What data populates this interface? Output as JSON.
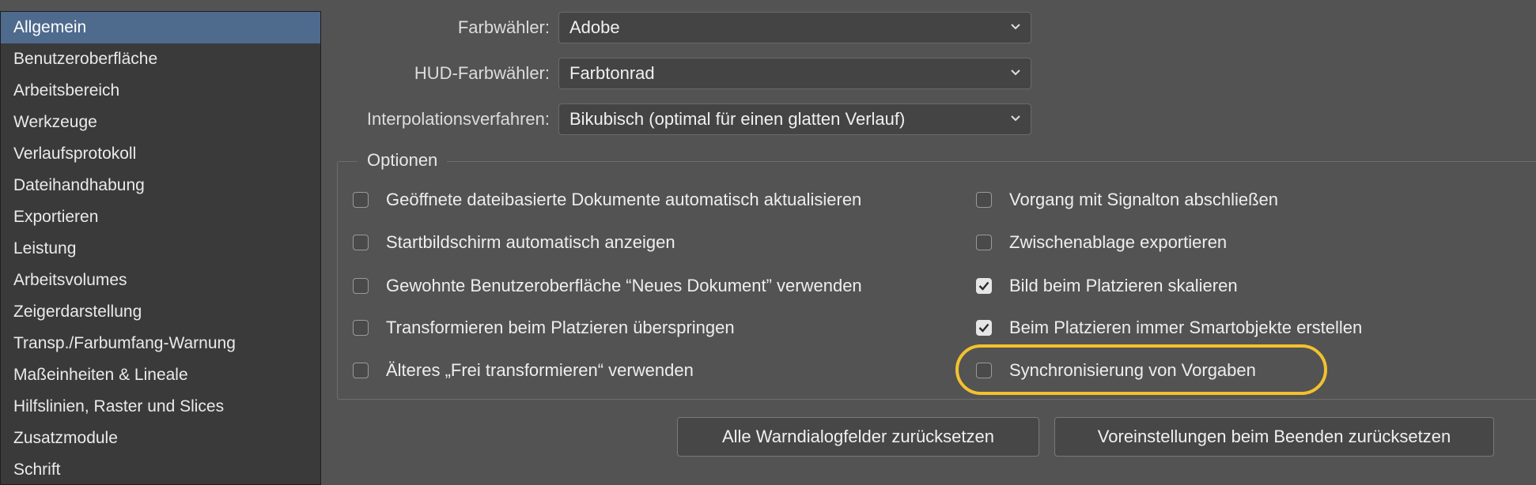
{
  "sidebar": {
    "items": [
      {
        "label": "Allgemein",
        "active": true
      },
      {
        "label": "Benutzeroberfläche"
      },
      {
        "label": "Arbeitsbereich"
      },
      {
        "label": "Werkzeuge"
      },
      {
        "label": "Verlaufsprotokoll"
      },
      {
        "label": "Dateihandhabung"
      },
      {
        "label": "Exportieren"
      },
      {
        "label": "Leistung"
      },
      {
        "label": "Arbeitsvolumes"
      },
      {
        "label": "Zeigerdarstellung"
      },
      {
        "label": "Transp./Farbumfang-Warnung"
      },
      {
        "label": "Maßeinheiten & Lineale"
      },
      {
        "label": "Hilfslinien, Raster und Slices"
      },
      {
        "label": "Zusatzmodule"
      },
      {
        "label": "Schrift"
      }
    ]
  },
  "settings": {
    "color_picker": {
      "label": "Farbwähler:",
      "value": "Adobe"
    },
    "hud_color_picker": {
      "label": "HUD-Farbwähler:",
      "value": "Farbtonrad"
    },
    "interpolation": {
      "label": "Interpolationsverfahren:",
      "value": "Bikubisch (optimal für einen glatten Verlauf)"
    }
  },
  "options": {
    "title": "Optionen",
    "left": [
      {
        "label": "Geöffnete dateibasierte Dokumente automatisch aktualisieren",
        "checked": false
      },
      {
        "label": "Startbildschirm automatisch anzeigen",
        "checked": false
      },
      {
        "label": "Gewohnte Benutzeroberfläche “Neues Dokument” verwenden",
        "checked": false
      },
      {
        "label": "Transformieren beim Platzieren überspringen",
        "checked": false
      },
      {
        "label": "Älteres „Frei transformieren“ verwenden",
        "checked": false
      }
    ],
    "right": [
      {
        "label": "Vorgang mit Signalton abschließen",
        "checked": false
      },
      {
        "label": "Zwischenablage exportieren",
        "checked": false
      },
      {
        "label": "Bild beim Platzieren skalieren",
        "checked": true
      },
      {
        "label": "Beim Platzieren immer Smartobjekte erstellen",
        "checked": true
      },
      {
        "label": "Synchronisierung von Vorgaben",
        "checked": false
      }
    ]
  },
  "buttons": {
    "reset_warnings": "Alle Warndialogfelder zurücksetzen",
    "reset_prefs": "Voreinstellungen beim Beenden zurücksetzen"
  },
  "colors": {
    "highlight": "#f2c12e",
    "active_item": "#4e6a8d"
  }
}
